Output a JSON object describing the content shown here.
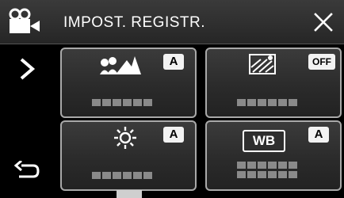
{
  "header": {
    "title": "IMPOST. REGISTR.",
    "mode_icon": "video-camera-icon",
    "close_icon": "close-icon"
  },
  "nav": {
    "next_icon": "chevron-right-icon",
    "back_icon": "return-arrow-icon"
  },
  "tiles": [
    {
      "icon": "scene-mountains-icon",
      "badge": "A"
    },
    {
      "icon": "backlight-compensation-icon",
      "badge": "OFF"
    },
    {
      "icon": "brightness-sun-icon",
      "badge": "A"
    },
    {
      "icon": "white-balance-icon",
      "glyph_text": "WB",
      "badge": "A"
    }
  ],
  "colors": {
    "background": "#000000",
    "tile_border": "#a9a9a9",
    "badge_bg": "#f2f2f2",
    "placeholder_dots": "#8a8a8a"
  }
}
